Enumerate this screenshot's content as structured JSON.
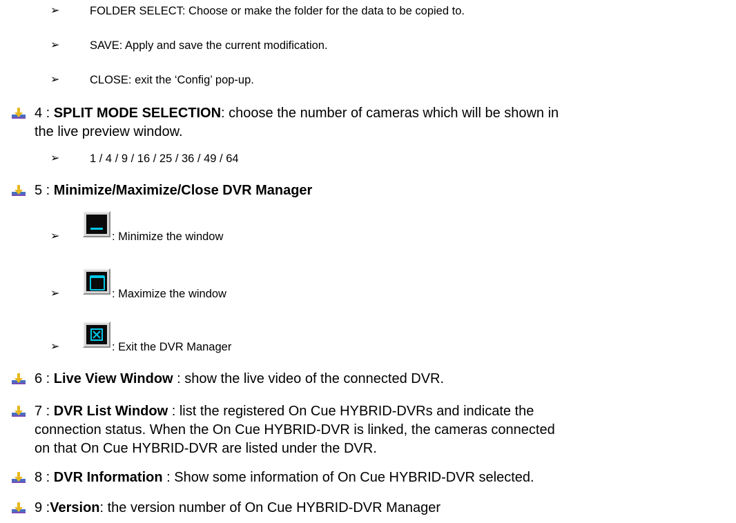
{
  "items": {
    "folder_select": "FOLDER SELECT: Choose or make the folder for the data to be copied to.",
    "save": "SAVE: Apply and save the current modification.",
    "close": "CLOSE: exit the ‘Config’ pop-up.",
    "split_num": "4 : ",
    "split_title": "SPLIT MODE SELECTION",
    "split_desc_1": ": choose the number of cameras which will be shown in",
    "split_desc_2": "the live preview window.",
    "split_options": "1 / 4 / 9 / 16 / 25 / 36 / 49 / 64",
    "window_num": "5 : ",
    "window_title": "Minimize/Maximize/Close DVR Manager",
    "minimize_desc": ": Minimize the window",
    "maximize_desc": ": Maximize the window",
    "exit_desc": ": Exit the DVR Manager",
    "live_num": "6 : ",
    "live_title": "Live View Window",
    "live_desc": " : show the live video of the connected DVR.",
    "list_num": "7 : ",
    "list_title": "DVR List Window",
    "list_desc_1": " : list the registered On Cue HYBRID-DVRs and indicate the",
    "list_desc_2": "connection status. When the On Cue HYBRID-DVR is linked, the cameras connected",
    "list_desc_3": "on that On Cue HYBRID-DVR are listed under the DVR.",
    "info_num": "8 : ",
    "info_title": "DVR Information",
    "info_desc": " : Show some information of On Cue HYBRID-DVR selected.",
    "version_num": "9 :",
    "version_title": "Version",
    "version_desc": ": the version number of On Cue HYBRID-DVR Manager"
  },
  "icons": {
    "sub_bullet": "right-arrowhead-icon",
    "main_bullet": "down-arrow-bullet-icon",
    "accent_color": "#00c8e8",
    "bullet_colors": [
      "#4a7fc8",
      "#7a4ab8",
      "#e8c020"
    ]
  }
}
